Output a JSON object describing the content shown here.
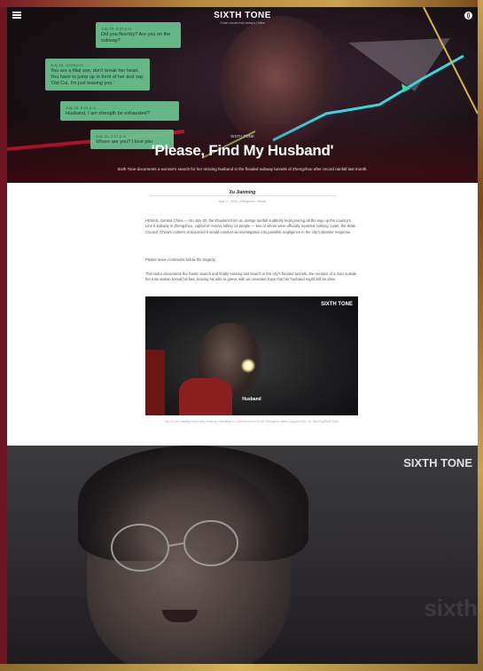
{
  "header": {
    "logo": "SIXTH TONE",
    "logo_tagline": "Fresh voices from today's China"
  },
  "hero": {
    "bubbles": [
      {
        "time": "July 20, 8:37 p.m.",
        "text": "Did you flee/dry? Are you on the subway?"
      },
      {
        "time": "July 20, 10:00 p.m.",
        "text": "You are a filial son, don't break her heart. You have to jump up in front of her and say 'Old Cui, I'm just teasing you.'"
      },
      {
        "time": "July 26, 8:24 p.m.",
        "text": "Husband, I am strength be exhausted?"
      },
      {
        "time": "July 31, 2:17 p.m.",
        "text": "Where are you? I love you"
      }
    ],
    "category": "SIXTH TONE",
    "title": "'Please, Find My Husband'",
    "subtitle": "Sixth Tone documents a woman's search for her missing husband in the flooded subway tunnels of Zhengzhou after record rainfall last month."
  },
  "article": {
    "byline": "Xu Jianming",
    "dateline": "Aug 17, 2021   |   Zhengzhou, Henan",
    "paragraphs": [
      "HENAN, Central China — On July 20, the Zhaolei's from an orange rainfall suddenly kept pouring all the way up the country's Line 5 subway in Zhengzhou, capital of Henan, killing 14 people — two of whom were officially reported missing. Later, the State Council, China's cabinet, announced it would conduct an investigation into possible negligence in the city's disaster response.",
      "Please leave comments below the tragedy.",
      "This video documents the frantic search and finally missing last search in the city's flooded tunnels, the remains of a man outside the train station reveal his fate, leaving his wife to grieve with an uncertain hope that her husband might still be alive."
    ],
    "video_caption": "Husband",
    "video_watermark": "SIXTH TONE",
    "video_credit": "Wu Lu, the missing man's wife, holds up a flashlight in a flooded tunnel of the Zhengzhou Metro, August 2021. Xu Jianming/Sixth Tone"
  },
  "lower_frame": {
    "watermark": "SIXTH TONE",
    "watermark_faint": "sixth"
  }
}
